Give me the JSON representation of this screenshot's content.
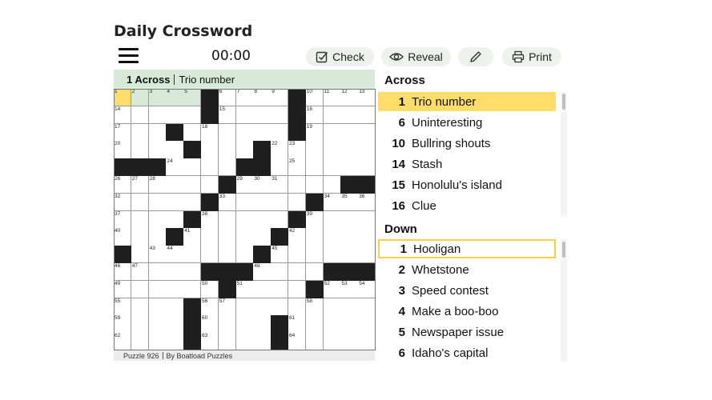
{
  "app": {
    "title": "Daily Crossword",
    "timer": "00:00"
  },
  "toolbar": {
    "check": "Check",
    "reveal": "Reveal",
    "print": "Print"
  },
  "current_clue": {
    "label": "1 Across",
    "text": "Trio number"
  },
  "grid": {
    "size": 15,
    "rows": [
      "....##...#.....",
      ".....#.........",
      "..#.....#......",
      "...#....#......",
      ".#......##.....",
      "#...#....#...##",
      "...#......#....",
      "...#......#....",
      "....#.....#....",
      "#.........#....",
      "......#......##",
      ".....#...##....",
      ".........#.....",
      "...#.....#.....",
      "...#......#...."
    ],
    "blacks": [
      [
        0,
        5
      ],
      [
        1,
        5
      ],
      [
        3,
        4
      ],
      [
        4,
        0
      ],
      [
        4,
        1
      ],
      [
        4,
        2
      ],
      [
        4,
        7
      ],
      [
        4,
        8
      ],
      [
        5,
        6
      ],
      [
        5,
        13
      ],
      [
        5,
        14
      ],
      [
        6,
        5
      ],
      [
        6,
        11
      ],
      [
        7,
        4
      ],
      [
        7,
        10
      ],
      [
        8,
        3
      ],
      [
        8,
        9
      ],
      [
        9,
        0
      ],
      [
        9,
        8
      ],
      [
        10,
        5
      ],
      [
        10,
        6
      ],
      [
        10,
        7
      ],
      [
        10,
        12
      ],
      [
        10,
        13
      ],
      [
        10,
        14
      ],
      [
        11,
        6
      ],
      [
        11,
        11
      ],
      [
        12,
        4
      ],
      [
        13,
        4
      ],
      [
        13,
        9
      ],
      [
        14,
        4
      ],
      [
        14,
        9
      ],
      [
        0,
        10
      ],
      [
        1,
        10
      ],
      [
        2,
        10
      ],
      [
        3,
        8
      ],
      [
        2,
        3
      ]
    ],
    "numbers": [
      {
        "r": 0,
        "c": 0,
        "n": "1"
      },
      {
        "r": 0,
        "c": 1,
        "n": "2"
      },
      {
        "r": 0,
        "c": 2,
        "n": "3"
      },
      {
        "r": 0,
        "c": 3,
        "n": "4"
      },
      {
        "r": 0,
        "c": 4,
        "n": "5"
      },
      {
        "r": 0,
        "c": 6,
        "n": "6"
      },
      {
        "r": 0,
        "c": 7,
        "n": "7"
      },
      {
        "r": 0,
        "c": 8,
        "n": "8"
      },
      {
        "r": 0,
        "c": 9,
        "n": "9"
      },
      {
        "r": 0,
        "c": 11,
        "n": "10"
      },
      {
        "r": 0,
        "c": 12,
        "n": "11"
      },
      {
        "r": 0,
        "c": 13,
        "n": "12"
      },
      {
        "r": 0,
        "c": 14,
        "n": "13"
      },
      {
        "r": 1,
        "c": 0,
        "n": "14"
      },
      {
        "r": 1,
        "c": 6,
        "n": "15"
      },
      {
        "r": 1,
        "c": 11,
        "n": "16"
      },
      {
        "r": 2,
        "c": 0,
        "n": "17"
      },
      {
        "r": 2,
        "c": 5,
        "n": "18"
      },
      {
        "r": 2,
        "c": 11,
        "n": "19"
      },
      {
        "r": 3,
        "c": 0,
        "n": "20"
      },
      {
        "r": 3,
        "c": 4,
        "n": "21"
      },
      {
        "r": 3,
        "c": 9,
        "n": "22"
      },
      {
        "r": 3,
        "c": 10,
        "n": "23"
      },
      {
        "r": 4,
        "c": 3,
        "n": "24"
      },
      {
        "r": 4,
        "c": 10,
        "n": "25"
      },
      {
        "r": 5,
        "c": 0,
        "n": "26"
      },
      {
        "r": 5,
        "c": 1,
        "n": "27"
      },
      {
        "r": 5,
        "c": 2,
        "n": "28"
      },
      {
        "r": 5,
        "c": 7,
        "n": "29"
      },
      {
        "r": 5,
        "c": 8,
        "n": "30"
      },
      {
        "r": 5,
        "c": 9,
        "n": "31"
      },
      {
        "r": 6,
        "c": 0,
        "n": "32"
      },
      {
        "r": 6,
        "c": 6,
        "n": "33"
      },
      {
        "r": 6,
        "c": 12,
        "n": "34"
      },
      {
        "r": 6,
        "c": 13,
        "n": "35"
      },
      {
        "r": 6,
        "c": 14,
        "n": "36"
      },
      {
        "r": 7,
        "c": 0,
        "n": "37"
      },
      {
        "r": 7,
        "c": 5,
        "n": "38"
      },
      {
        "r": 7,
        "c": 11,
        "n": "39"
      },
      {
        "r": 8,
        "c": 0,
        "n": "40"
      },
      {
        "r": 8,
        "c": 4,
        "n": "41"
      },
      {
        "r": 8,
        "c": 10,
        "n": "42"
      },
      {
        "r": 9,
        "c": 2,
        "n": "43"
      },
      {
        "r": 9,
        "c": 3,
        "n": "44"
      },
      {
        "r": 9,
        "c": 9,
        "n": "45"
      },
      {
        "r": 10,
        "c": 0,
        "n": "46"
      },
      {
        "r": 10,
        "c": 1,
        "n": "47"
      },
      {
        "r": 10,
        "c": 8,
        "n": "48"
      },
      {
        "r": 11,
        "c": 0,
        "n": "49"
      },
      {
        "r": 11,
        "c": 5,
        "n": "50"
      },
      {
        "r": 11,
        "c": 7,
        "n": "51"
      },
      {
        "r": 11,
        "c": 12,
        "n": "52"
      },
      {
        "r": 11,
        "c": 13,
        "n": "53"
      },
      {
        "r": 11,
        "c": 14,
        "n": "54"
      },
      {
        "r": 12,
        "c": 0,
        "n": "55"
      },
      {
        "r": 12,
        "c": 5,
        "n": "56"
      },
      {
        "r": 12,
        "c": 6,
        "n": "57"
      },
      {
        "r": 12,
        "c": 11,
        "n": "58"
      },
      {
        "r": 13,
        "c": 0,
        "n": "59"
      },
      {
        "r": 13,
        "c": 5,
        "n": "60"
      },
      {
        "r": 13,
        "c": 10,
        "n": "61"
      },
      {
        "r": 14,
        "c": 0,
        "n": "62"
      },
      {
        "r": 14,
        "c": 5,
        "n": "63"
      },
      {
        "r": 14,
        "c": 10,
        "n": "64"
      }
    ],
    "selected": [
      0,
      0
    ],
    "word": [
      [
        0,
        1
      ],
      [
        0,
        2
      ],
      [
        0,
        3
      ],
      [
        0,
        4
      ]
    ]
  },
  "footer": {
    "puzzle": "Puzzle 926",
    "credit": "By Boatload Puzzles"
  },
  "across": {
    "heading": "Across",
    "items": [
      {
        "n": "1",
        "t": "Trio number"
      },
      {
        "n": "6",
        "t": "Uninteresting"
      },
      {
        "n": "10",
        "t": "Bullring shouts"
      },
      {
        "n": "14",
        "t": "Stash"
      },
      {
        "n": "15",
        "t": "Honolulu's island"
      },
      {
        "n": "16",
        "t": "Clue"
      }
    ]
  },
  "down": {
    "heading": "Down",
    "items": [
      {
        "n": "1",
        "t": "Hooligan"
      },
      {
        "n": "2",
        "t": "Whetstone"
      },
      {
        "n": "3",
        "t": "Speed contest"
      },
      {
        "n": "4",
        "t": "Make a boo-boo"
      },
      {
        "n": "5",
        "t": "Newspaper issue"
      },
      {
        "n": "6",
        "t": "Idaho's capital"
      }
    ]
  },
  "colors": {
    "selected": "#ffdd6b",
    "word": "#d7e9d9",
    "black": "#1f1f1f"
  },
  "icons": {
    "menu": "hamburger-icon",
    "check": "check-square-icon",
    "reveal": "eye-icon",
    "pencil": "pencil-icon",
    "print": "printer-icon"
  }
}
